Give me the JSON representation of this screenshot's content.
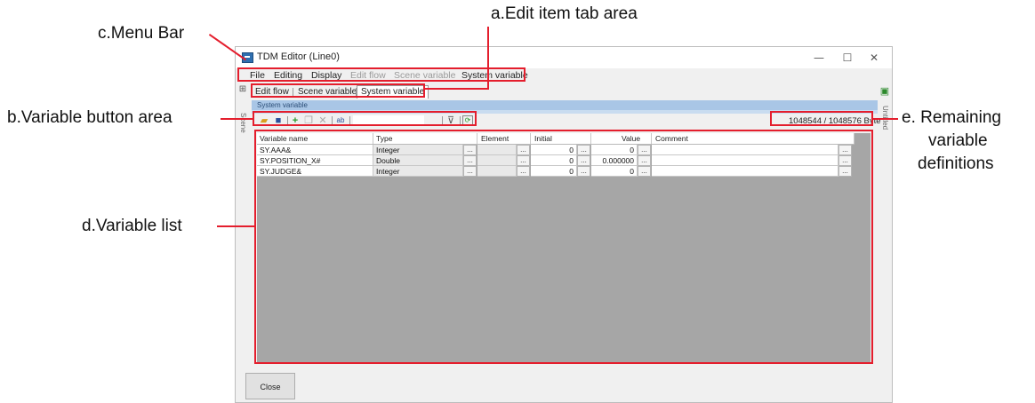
{
  "annotations": {
    "edit_tab_area": "a.Edit item tab area",
    "menu_bar": "c.Menu Bar",
    "variable_button_area": "b.Variable button area",
    "remaining_line1": "e. Remaining",
    "remaining_line2": "variable",
    "remaining_line3": "definitions",
    "variable_list": "d.Variable list"
  },
  "window": {
    "title": "TDM Editor (Line0)",
    "minimize": "—",
    "maximize": "☐",
    "close": "✕"
  },
  "menu": {
    "items": [
      {
        "label": "File",
        "enabled": true
      },
      {
        "label": "Editing",
        "enabled": true
      },
      {
        "label": "Display",
        "enabled": true
      },
      {
        "label": "Edit flow",
        "enabled": false
      },
      {
        "label": "Scene variable",
        "enabled": false
      },
      {
        "label": "System variable",
        "enabled": true
      }
    ]
  },
  "tabs": [
    {
      "label": "Edit flow",
      "active": false
    },
    {
      "label": "Scene variable",
      "active": false
    },
    {
      "label": "System variable",
      "active": true
    }
  ],
  "section_title": "System variable",
  "remaining": "1048544 / 1048576 Byte",
  "side_labels": {
    "left": "Scene",
    "right": "Untitled"
  },
  "table": {
    "headers": [
      "Variable name",
      "Type",
      "Element",
      "Initial",
      "Value",
      "Comment"
    ],
    "rows": [
      {
        "name": "SY.AAA&",
        "type": "Integer",
        "element": "",
        "initial": "0",
        "value": "0",
        "comment": ""
      },
      {
        "name": "SY.POSITION_X#",
        "type": "Double",
        "element": "",
        "initial": "0",
        "value": "0.000000",
        "comment": ""
      },
      {
        "name": "SY.JUDGE&",
        "type": "Integer",
        "element": "",
        "initial": "0",
        "value": "0",
        "comment": ""
      }
    ],
    "ellipsis": "..."
  },
  "buttons": {
    "close": "Close"
  },
  "colors": {
    "annotation_red": "#e41e2d",
    "section_bar": "#a9c6e6",
    "list_background": "#a6a6a6"
  }
}
